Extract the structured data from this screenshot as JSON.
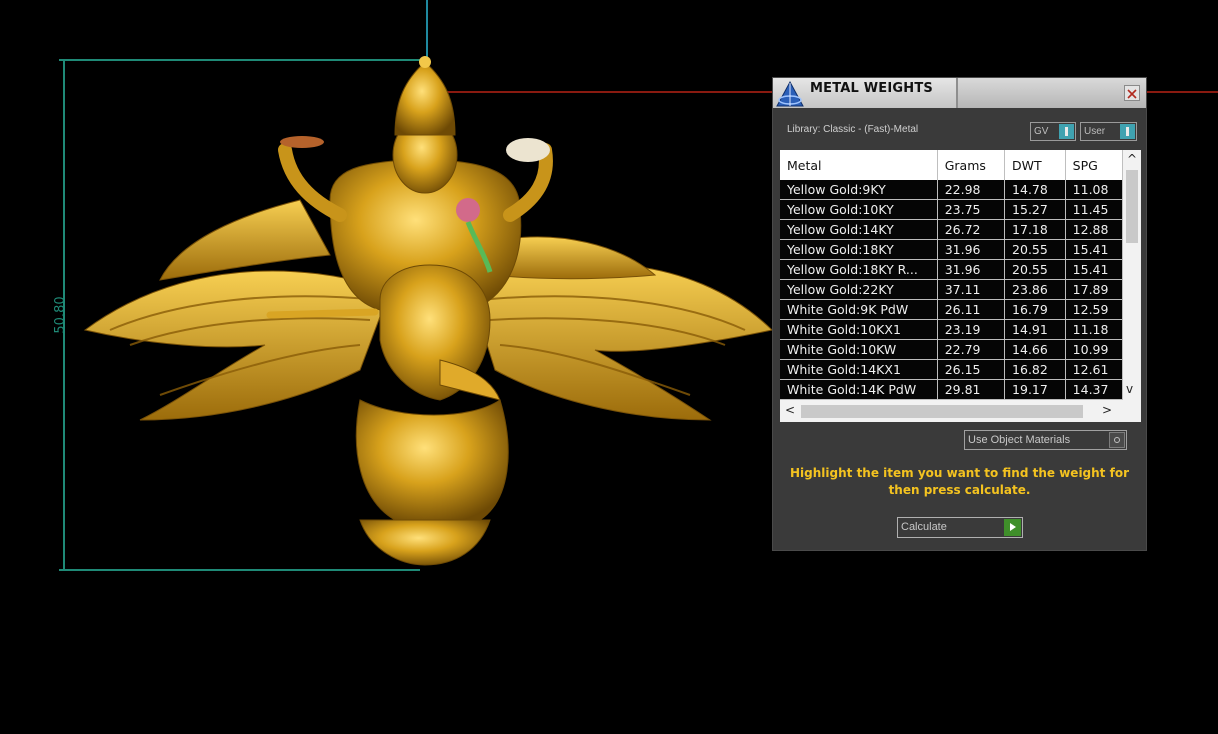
{
  "viewport": {
    "dimension_label": "50.80",
    "model_description": "Gold Vishnu on Garuda pendant"
  },
  "dialog": {
    "title": "METAL WEIGHTS",
    "library_label": "Library: Classic - (Fast)-Metal",
    "toggle_gv": "GV",
    "toggle_user": "User",
    "columns": [
      "Metal",
      "Grams",
      "DWT",
      "SPG"
    ],
    "rows": [
      [
        "Yellow Gold:9KY",
        "22.98",
        "14.78",
        "11.08"
      ],
      [
        "Yellow Gold:10KY",
        "23.75",
        "15.27",
        "11.45"
      ],
      [
        "Yellow Gold:14KY",
        "26.72",
        "17.18",
        "12.88"
      ],
      [
        "Yellow Gold:18KY",
        "31.96",
        "20.55",
        "15.41"
      ],
      [
        "Yellow Gold:18KY R...",
        "31.96",
        "20.55",
        "15.41"
      ],
      [
        "Yellow Gold:22KY",
        "37.11",
        "23.86",
        "17.89"
      ],
      [
        "White Gold:9K PdW",
        "26.11",
        "16.79",
        "12.59"
      ],
      [
        "White Gold:10KX1",
        "23.19",
        "14.91",
        "11.18"
      ],
      [
        "White Gold:10KW",
        "22.79",
        "14.66",
        "10.99"
      ],
      [
        "White Gold:14KX1",
        "26.15",
        "16.82",
        "12.61"
      ],
      [
        "White Gold:14K PdW",
        "29.81",
        "19.17",
        "14.37"
      ]
    ],
    "use_object_materials": "Use Object Materials",
    "instruction": "Highlight the item you want to find the weight for then press calculate.",
    "calculate_label": "Calculate"
  },
  "colors": {
    "gold": "#d4a017",
    "dimension": "#1f8a77",
    "axis_red": "#8a1a10",
    "instruction": "#f4c320"
  }
}
